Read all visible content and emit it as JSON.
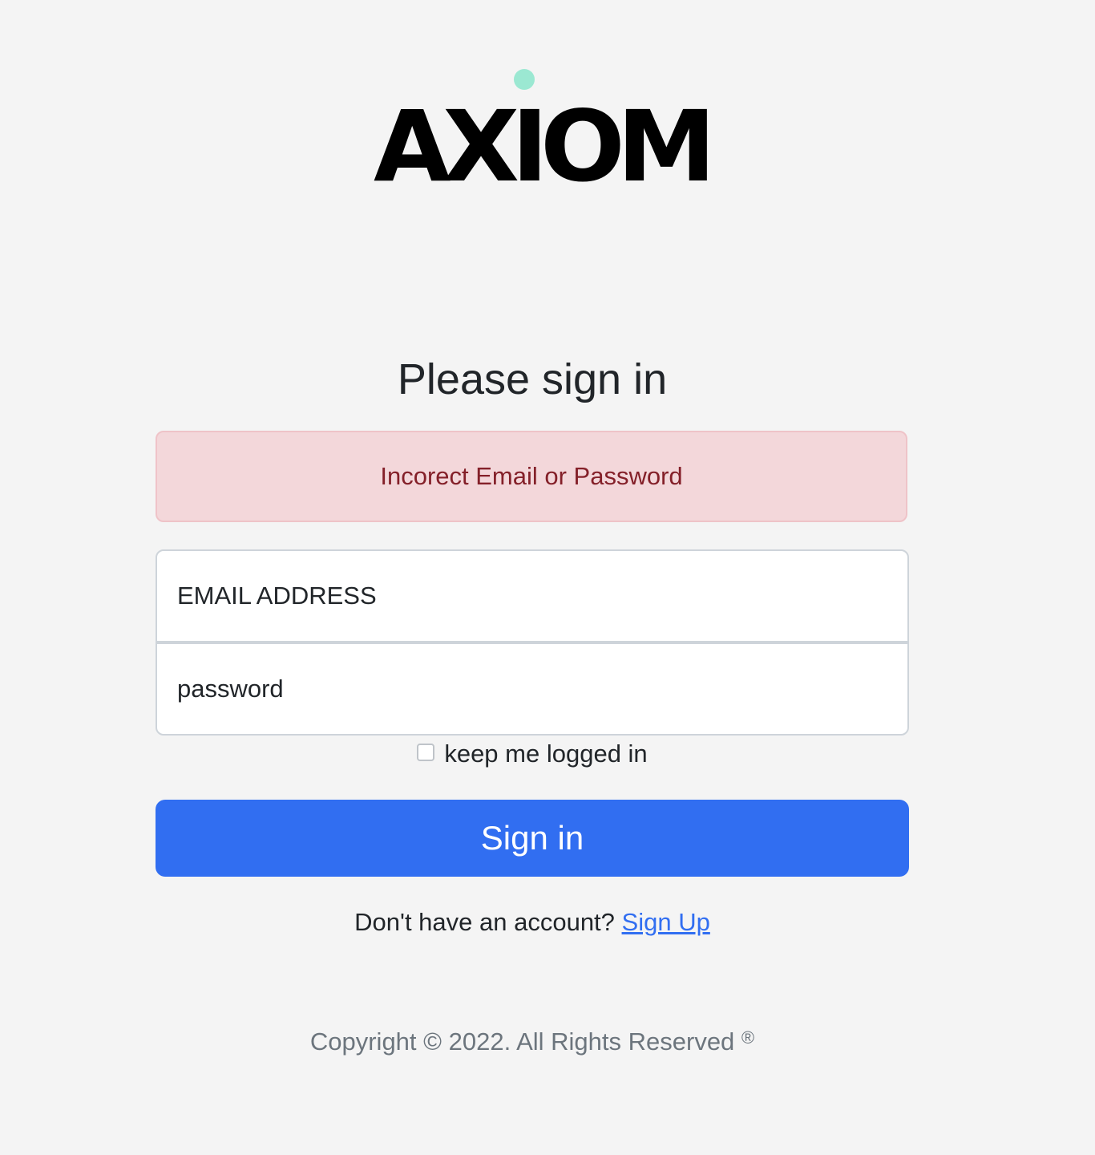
{
  "brand": {
    "logo_text": "AXIOM",
    "logo_dot_color": "#9be8d2"
  },
  "form": {
    "title": "Please sign in",
    "error_message": "Incorect Email or Password",
    "email_placeholder": "EMAIL ADDRESS",
    "password_placeholder": "password",
    "remember_label": "keep me logged in",
    "remember_checked": false,
    "submit_label": "Sign in",
    "signup_prompt": "Don't have an account?",
    "signup_link": "Sign Up"
  },
  "footer": {
    "copyright": "Copyright © 2022. All Rights Reserved",
    "registered_mark": "®"
  },
  "colors": {
    "accent": "#316ef1",
    "error_bg": "#f3d7da",
    "error_text": "#842029",
    "background": "#f4f4f4"
  }
}
